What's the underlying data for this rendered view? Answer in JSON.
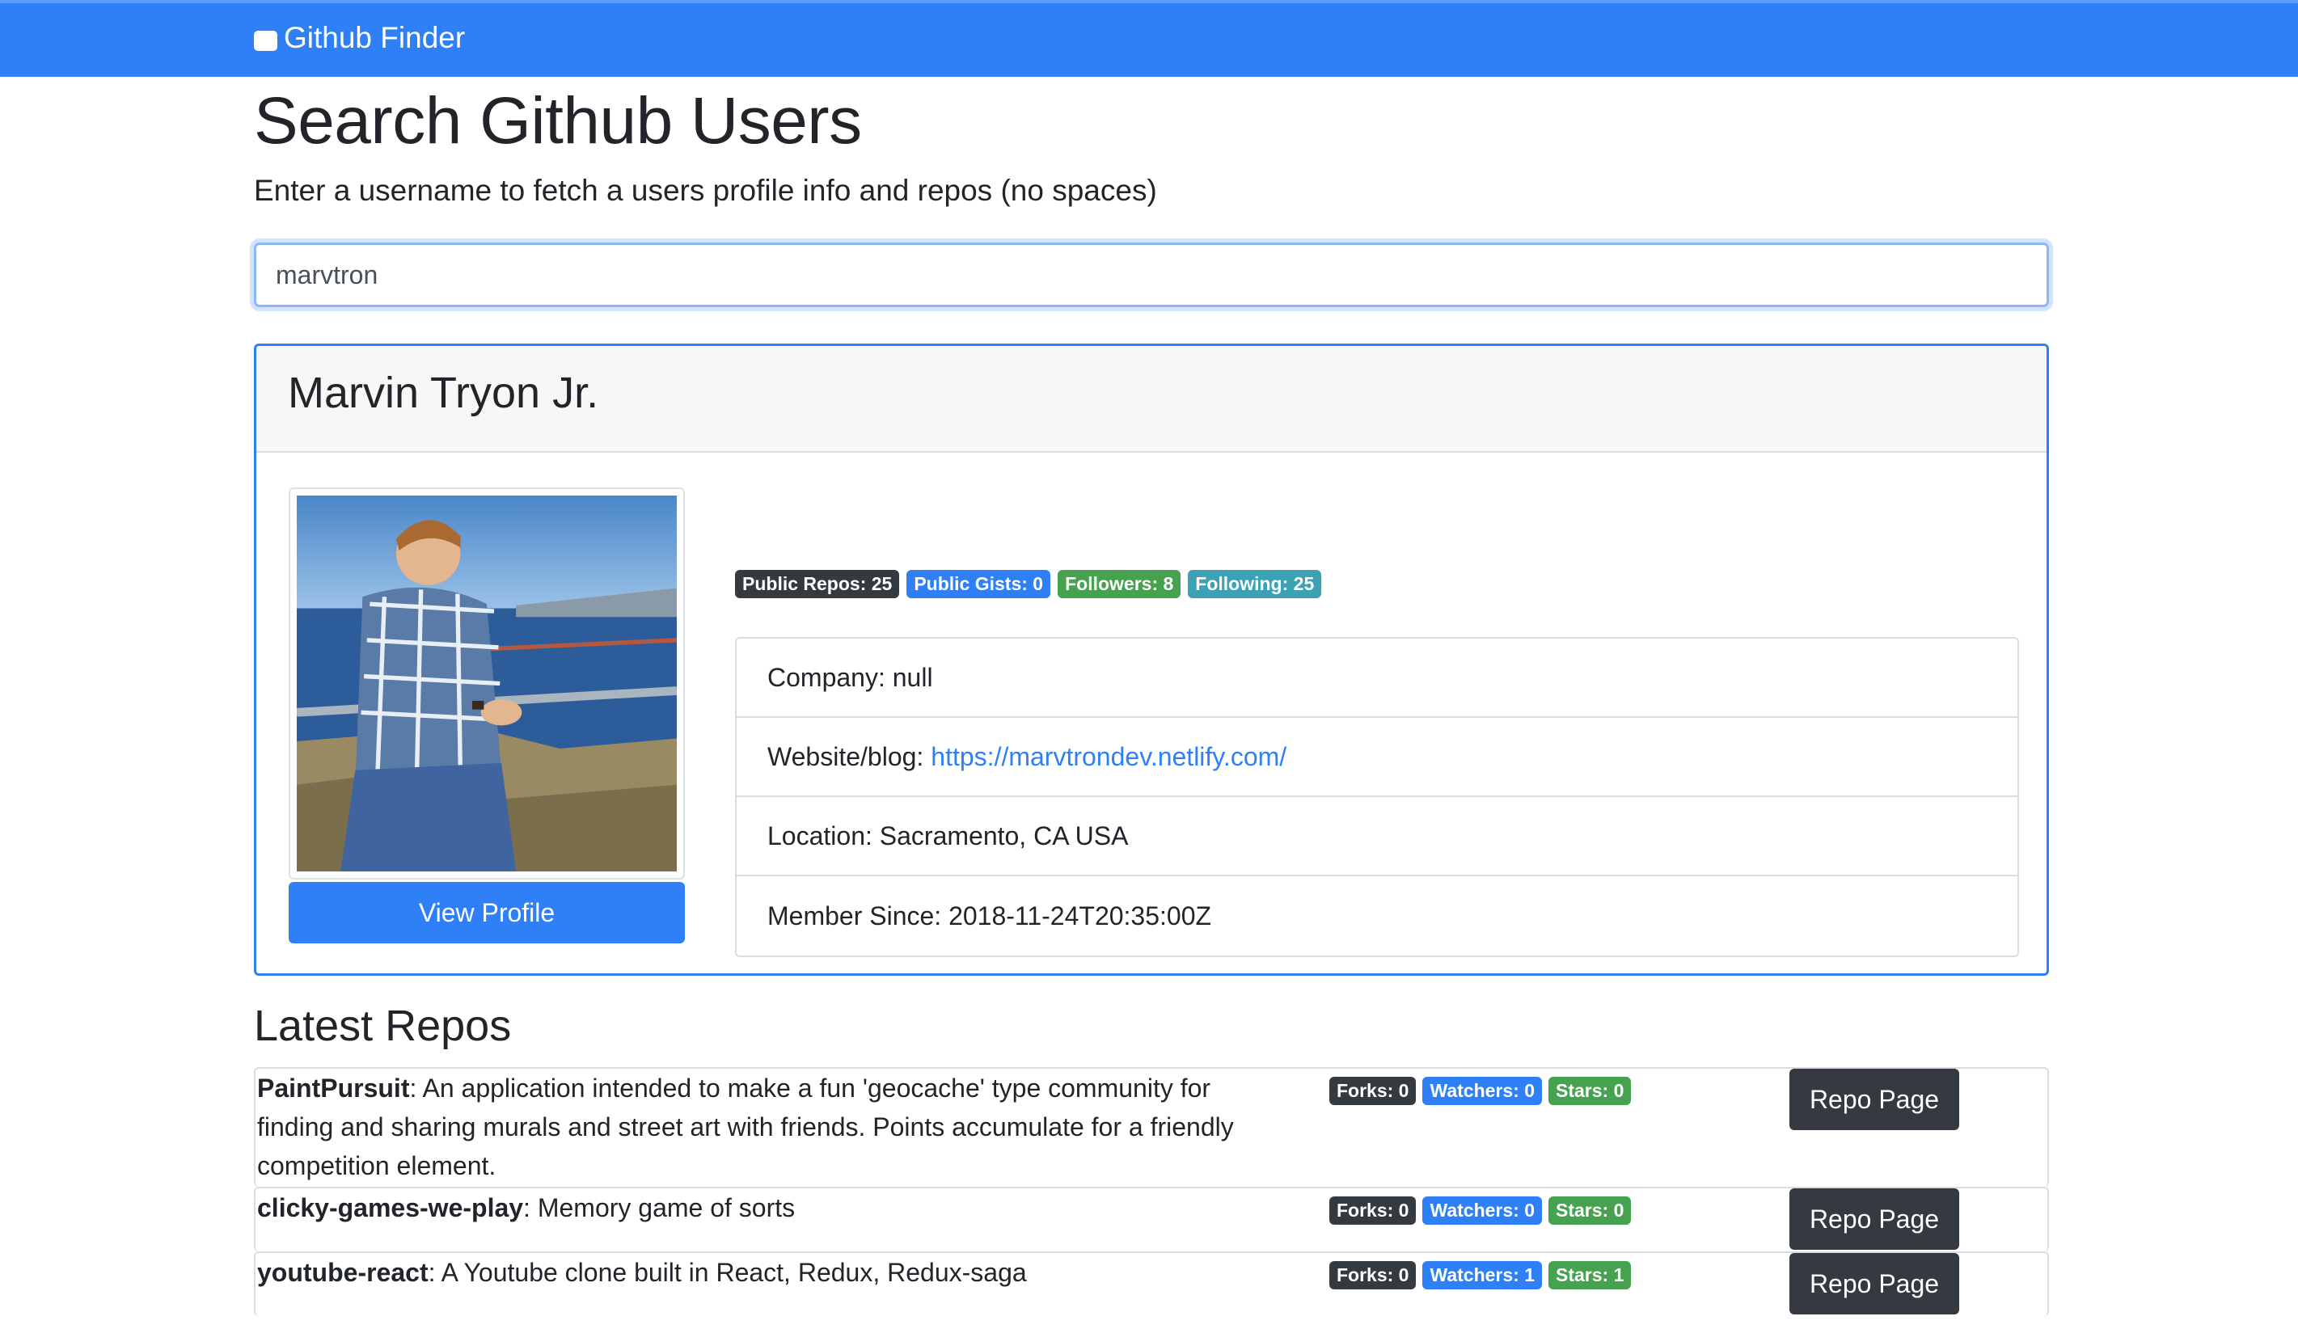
{
  "navbar": {
    "brand": "Github Finder",
    "brand_icon": "github-icon"
  },
  "header": {
    "title": "Search Github Users",
    "lead": "Enter a username to fetch a users profile info and repos (no spaces)"
  },
  "search": {
    "value": "marvtron"
  },
  "profile": {
    "name": "Marvin Tryon Jr.",
    "view_profile_label": "View Profile",
    "badges": {
      "public_repos": "Public Repos: 25",
      "public_gists": "Public Gists: 0",
      "followers": "Followers: 8",
      "following": "Following: 25"
    },
    "company": "Company: null",
    "website_label": "Website/blog:",
    "website_url": "https://marvtrondev.netlify.com/",
    "location": "Location: Sacramento, CA USA",
    "member_since": "Member Since: 2018-11-24T20:35:00Z"
  },
  "repos": {
    "title": "Latest Repos",
    "button_label": "Repo Page",
    "items": [
      {
        "name": "PaintPursuit",
        "description": ": An application intended to make a fun 'geocache' type community for finding and sharing murals and street art with friends. Points accumulate for a friendly competition element.",
        "forks": "Forks: 0",
        "watchers": "Watchers: 0",
        "stars": "Stars: 0"
      },
      {
        "name": "clicky-games-we-play",
        "description": ": Memory game of sorts",
        "forks": "Forks: 0",
        "watchers": "Watchers: 0",
        "stars": "Stars: 0"
      },
      {
        "name": "youtube-react",
        "description": ": A Youtube clone built in React, Redux, Redux-saga",
        "forks": "Forks: 0",
        "watchers": "Watchers: 1",
        "stars": "Stars: 1"
      }
    ]
  },
  "colors": {
    "primary": "#2f80f7",
    "dark": "#343a40",
    "success": "#47a24f",
    "info": "#3ba2b6"
  }
}
